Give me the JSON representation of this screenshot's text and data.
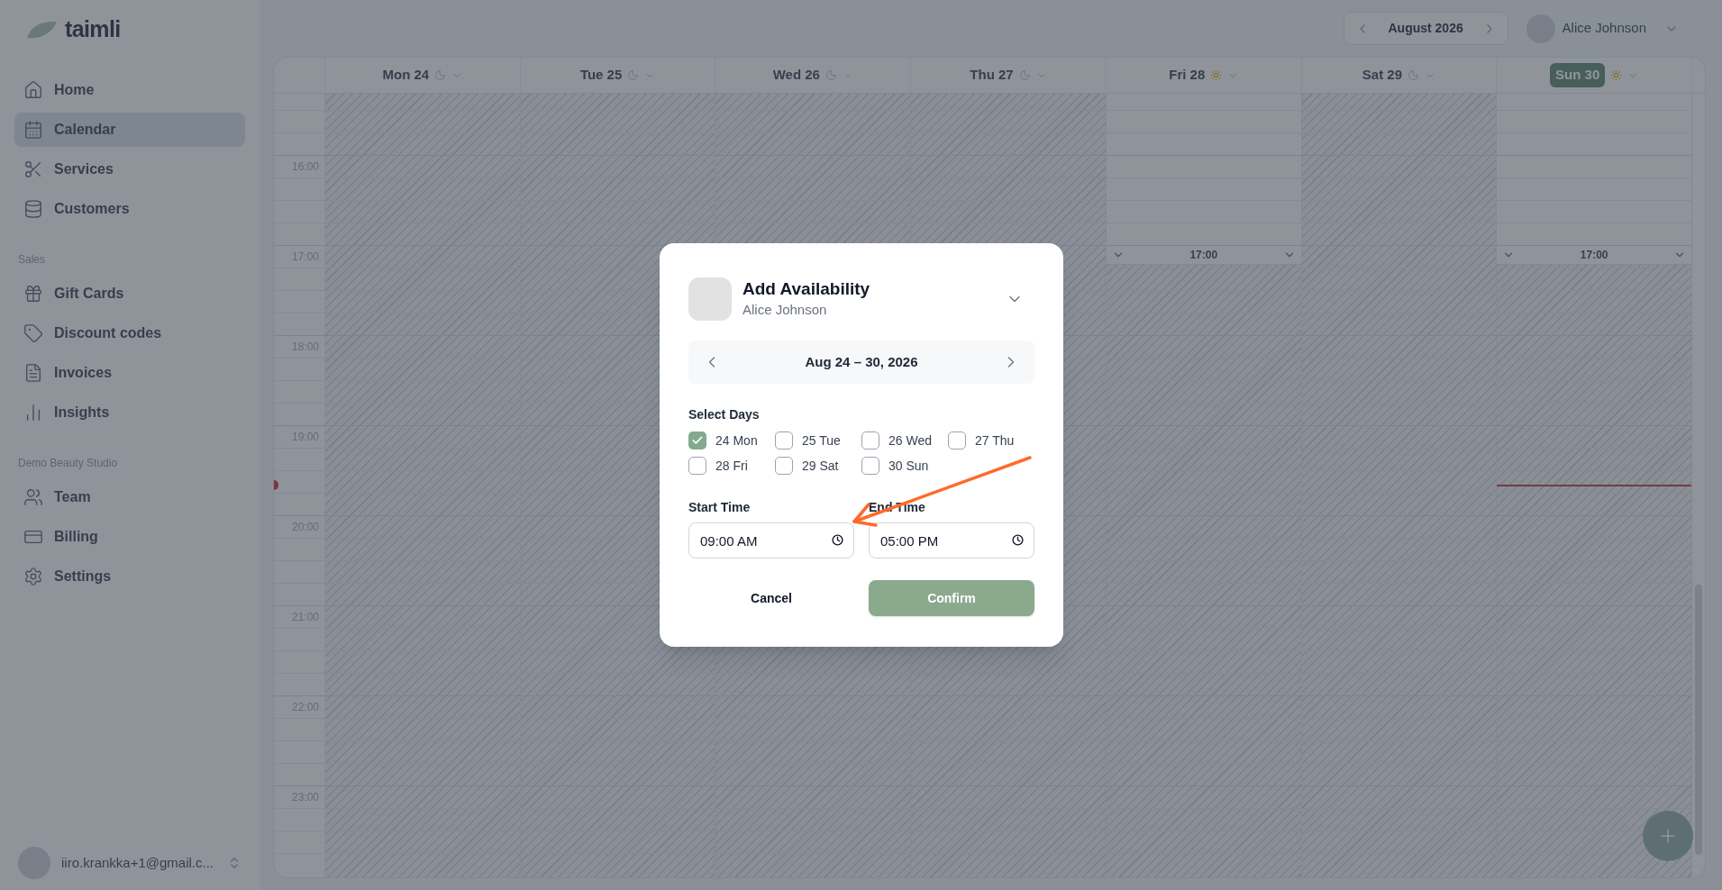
{
  "sidebar": {
    "logo": "taimli",
    "sections": [
      {
        "items": [
          {
            "label": "Home",
            "selected": false
          },
          {
            "label": "Calendar",
            "selected": true
          },
          {
            "label": "Services",
            "selected": false
          },
          {
            "label": "Customers",
            "selected": false
          }
        ]
      },
      {
        "label": "Sales",
        "items": [
          {
            "label": "Gift Cards",
            "selected": false
          },
          {
            "label": "Discount codes",
            "selected": false
          },
          {
            "label": "Invoices",
            "selected": false
          },
          {
            "label": "Insights",
            "selected": false
          }
        ]
      },
      {
        "label": "Demo Beauty Studio",
        "items": [
          {
            "label": "Team",
            "selected": false
          },
          {
            "label": "Billing",
            "selected": false
          },
          {
            "label": "Settings",
            "selected": false
          }
        ]
      }
    ],
    "account": {
      "email": "iiro.krankka+1@gmail.c..."
    }
  },
  "header": {
    "month": "August 2026",
    "user": "Alice Johnson"
  },
  "calendar": {
    "days": [
      {
        "label": "Mon 24",
        "kind": "blocked",
        "selected": false
      },
      {
        "label": "Tue 25",
        "kind": "blocked",
        "selected": false
      },
      {
        "label": "Wed 26",
        "kind": "blocked",
        "selected": false
      },
      {
        "label": "Thu 27",
        "kind": "blocked",
        "selected": false
      },
      {
        "label": "Fri 28",
        "kind": "open_until",
        "selected": false,
        "marker": "17:00"
      },
      {
        "label": "Sat 29",
        "kind": "blocked",
        "selected": false
      },
      {
        "label": "Sun 30",
        "kind": "open_until",
        "selected": true,
        "marker": "17:00"
      }
    ],
    "hours": [
      "16:00",
      "17:00",
      "18:00",
      "19:00",
      "20:00",
      "21:00",
      "22:00",
      "23:00"
    ]
  },
  "dialog": {
    "title": "Add Availability",
    "subtitle": "Alice Johnson",
    "week": "Aug 24 – 30, 2026",
    "days_label": "Select Days",
    "days": [
      {
        "label": "24 Mon",
        "checked": true
      },
      {
        "label": "25 Tue",
        "checked": false
      },
      {
        "label": "26 Wed",
        "checked": false
      },
      {
        "label": "27 Thu",
        "checked": false
      },
      {
        "label": "28 Fri",
        "checked": false
      },
      {
        "label": "29 Sat",
        "checked": false
      },
      {
        "label": "30 Sun",
        "checked": false
      }
    ],
    "start_label": "Start Time",
    "start_value": "09:00 AM",
    "end_label": "End Time",
    "end_value": "05:00 PM",
    "cancel": "Cancel",
    "confirm": "Confirm"
  }
}
